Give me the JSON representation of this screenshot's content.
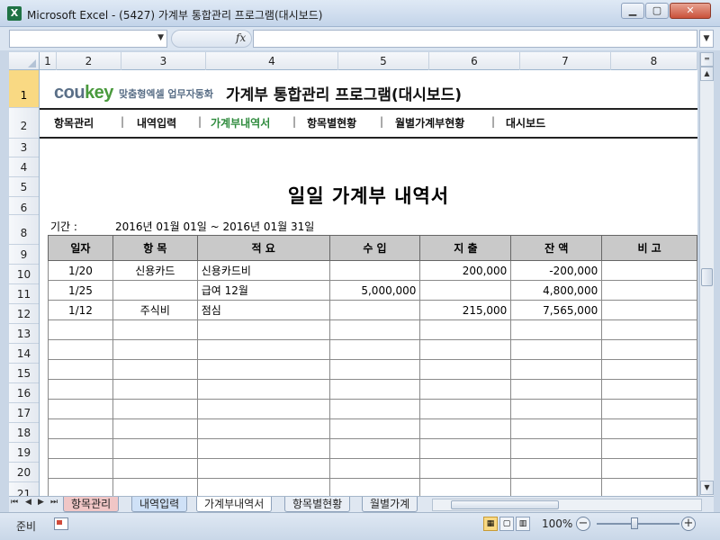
{
  "window": {
    "title": "Microsoft Excel - (5427) 가계부 통합관리 프로그램(대시보드)",
    "icon": "excel-icon",
    "controls": [
      "minimize-icon",
      "maximize-icon",
      "close-icon"
    ]
  },
  "formula_bar": {
    "name_box": "",
    "fx_label": "fx",
    "formula": ""
  },
  "columns": [
    "1",
    "2",
    "3",
    "4",
    "5",
    "6",
    "7",
    "8"
  ],
  "rows": [
    "1",
    "2",
    "3",
    "4",
    "5",
    "6",
    "8",
    "9",
    "10",
    "11",
    "12",
    "13",
    "14",
    "15",
    "16",
    "17",
    "18",
    "19",
    "20",
    "21"
  ],
  "brand": {
    "logo_part1": "cou",
    "logo_part2": "key",
    "tagline": "맞춤형엑셀 업무자동화",
    "app_title": "가계부 통합관리 프로그램(대시보드)"
  },
  "nav": [
    {
      "label": "항목관리"
    },
    {
      "label": "내역입력"
    },
    {
      "label": "가계부내역서"
    },
    {
      "label": "항목별현황"
    },
    {
      "label": "월별가계부현황"
    },
    {
      "label": "대시보드"
    }
  ],
  "document": {
    "title": "일일 가계부 내역서",
    "period_label": "기간 :",
    "period_value": "2016년 01월 01일 ~ 2016년 01월 31일"
  },
  "table": {
    "headers": [
      "일자",
      "항 목",
      "적 요",
      "수 입",
      "지 출",
      "잔 액",
      "비 고"
    ],
    "rows": [
      [
        "1/20",
        "신용카드",
        "신용카드비",
        "",
        "200,000",
        "-200,000",
        ""
      ],
      [
        "1/25",
        "",
        "급여 12월",
        "5,000,000",
        "",
        "4,800,000",
        ""
      ],
      [
        "1/12",
        "주식비",
        "점심",
        "",
        "215,000",
        "7,565,000",
        ""
      ],
      [
        "",
        "",
        "",
        "",
        "",
        "",
        ""
      ],
      [
        "",
        "",
        "",
        "",
        "",
        "",
        ""
      ],
      [
        "",
        "",
        "",
        "",
        "",
        "",
        ""
      ],
      [
        "",
        "",
        "",
        "",
        "",
        "",
        ""
      ],
      [
        "",
        "",
        "",
        "",
        "",
        "",
        ""
      ],
      [
        "",
        "",
        "",
        "",
        "",
        "",
        ""
      ],
      [
        "",
        "",
        "",
        "",
        "",
        "",
        ""
      ],
      [
        "",
        "",
        "",
        "",
        "",
        "",
        ""
      ],
      [
        "",
        "",
        "",
        "",
        "",
        "",
        ""
      ],
      [
        "",
        "",
        "",
        "",
        "",
        "",
        ""
      ]
    ]
  },
  "sheet_tabs": [
    "항목관리",
    "내역입력",
    "가계부내역서",
    "항목별현황",
    "월별가계"
  ],
  "status": {
    "ready": "준비",
    "zoom": "100%"
  },
  "colors": {
    "accent_nav": "#2e8b3d",
    "header_fill": "#c9c9c9",
    "active_row_header": "#f9d983"
  }
}
